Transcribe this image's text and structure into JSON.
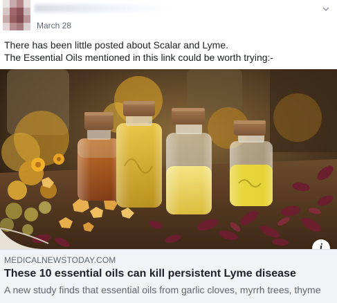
{
  "post": {
    "date": "March 28",
    "message_lines": [
      "There has been little posted about Scalar and Lyme.",
      "The Essential Oils mentioned in this link could be worth trying:-"
    ]
  },
  "link_preview": {
    "domain": "MEDICALNEWSTODAY.COM",
    "headline": "These 10 essential oils can kill persistent Lyme disease",
    "description": "A new study finds that essential oils from garlic cloves, myrrh trees, thyme",
    "info_glyph": "i",
    "image_subject": "essential oil bottles with cork stoppers among dried calendula flowers, rose petals and resin"
  },
  "icons": {
    "chevron": "chevron-down-icon",
    "info": "info-icon",
    "avatar": "avatar"
  },
  "colors": {
    "text_primary": "#1c1e21",
    "text_secondary": "#606770",
    "card_bg": "#f2f3f5",
    "border": "#dadde1"
  }
}
